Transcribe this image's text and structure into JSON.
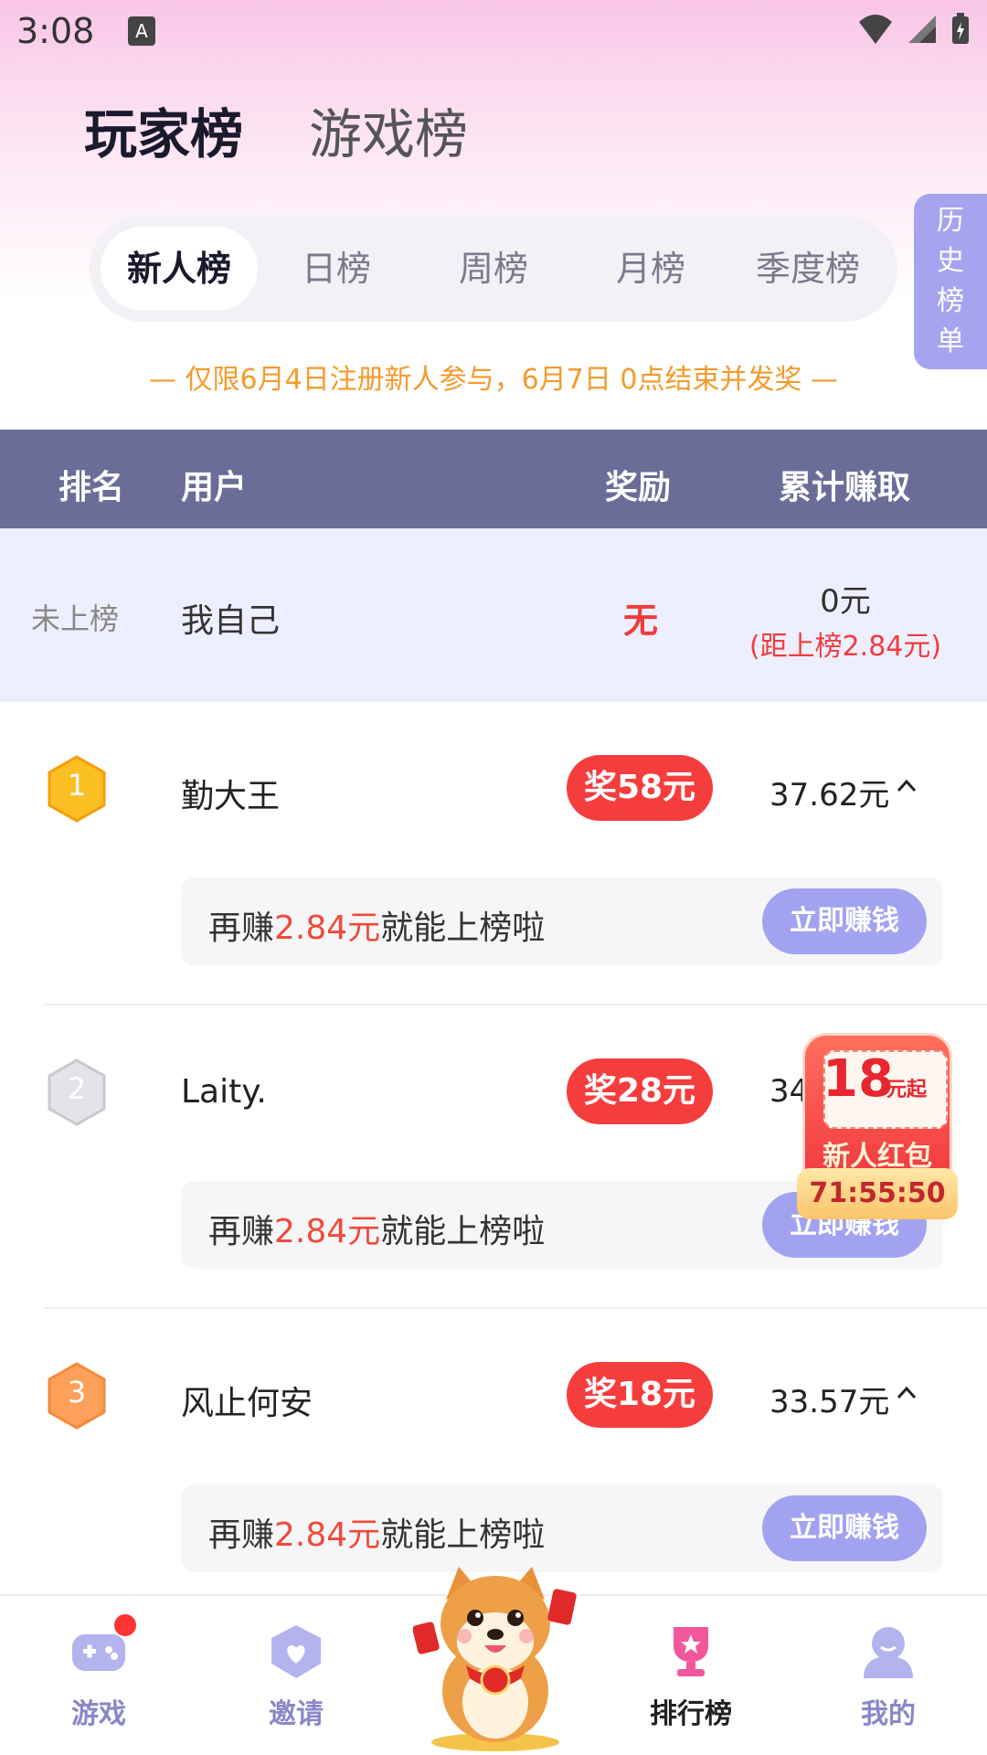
{
  "status_bar": {
    "time": "3:08",
    "app_badge": "A"
  },
  "main_tabs": [
    {
      "label": "玩家榜",
      "active": true
    },
    {
      "label": "游戏榜",
      "active": false
    }
  ],
  "sub_tabs": [
    {
      "label": "新人榜",
      "active": true
    },
    {
      "label": "日榜",
      "active": false
    },
    {
      "label": "周榜",
      "active": false
    },
    {
      "label": "月榜",
      "active": false
    },
    {
      "label": "季度榜",
      "active": false
    }
  ],
  "history_button": {
    "chars": [
      "历",
      "史",
      "榜",
      "单"
    ]
  },
  "notice": "— 仅限6月4日注册新人参与，6月7日 0点结束并发奖 —",
  "table_header": {
    "rank": "排名",
    "user": "用户",
    "reward": "奖励",
    "total": "累计赚取"
  },
  "me_row": {
    "rank": "未上榜",
    "name": "我自己",
    "reward": "无",
    "total": "0元",
    "gap": "(距上榜2.84元)"
  },
  "rows": [
    {
      "rank": "1",
      "name": "勤大王",
      "reward": "奖58元",
      "total": "37.62元",
      "hint_pre": "再赚",
      "hint_amount": "2.84元",
      "hint_post": "就能上榜啦",
      "button": "立即赚钱"
    },
    {
      "rank": "2",
      "name": "Laity.",
      "reward": "奖28元",
      "total": "34",
      "hint_pre": "再赚",
      "hint_amount": "2.84元",
      "hint_post": "就能上榜啦",
      "button": "立即赚钱"
    },
    {
      "rank": "3",
      "name": "风止何安",
      "reward": "奖18元",
      "total": "33.57元",
      "hint_pre": "再赚",
      "hint_amount": "2.84元",
      "hint_post": "就能上榜啦",
      "button": "立即赚钱"
    }
  ],
  "red_packet": {
    "amount": "18",
    "unit": "元起",
    "label": "新人红包",
    "timer": "71:55:50"
  },
  "bottom_nav": [
    {
      "label": "游戏",
      "icon": "gamepad-icon",
      "active": false
    },
    {
      "label": "邀请",
      "icon": "heart-shield-icon",
      "active": false
    },
    {
      "label": "排行榜",
      "icon": "trophy-icon",
      "active": true
    },
    {
      "label": "我的",
      "icon": "user-icon",
      "active": false
    }
  ],
  "colors": {
    "accent": "#a2a3f0",
    "reward_red": "#f53d3d",
    "header_bg": "#6b6d99",
    "notice_orange": "#f59a2b"
  }
}
